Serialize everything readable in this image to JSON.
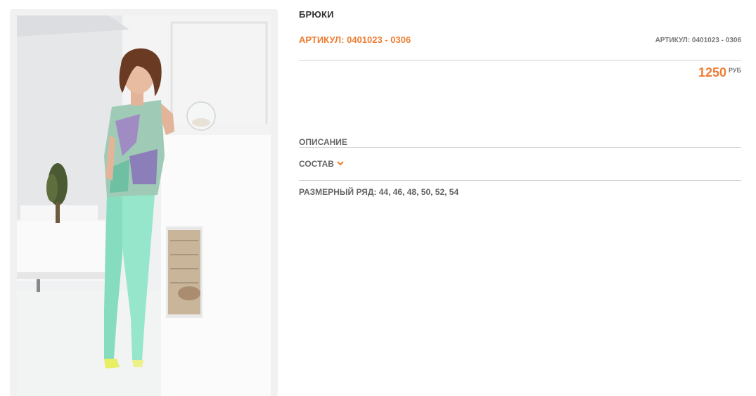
{
  "product": {
    "title": "БРЮКИ",
    "sku_main": "АРТИКУЛ: 0401023 - 0306",
    "sku_small": "АРТИКУЛ: 0401023 - 0306",
    "price_value": "1250",
    "price_unit": "РУБ"
  },
  "sections": {
    "description_label": "ОПИСАНИЕ",
    "composition_label": "СОСТАВ",
    "sizes_text": "РАЗМЕРНЫЙ РЯД: 44, 46, 48, 50, 52, 54"
  },
  "colors": {
    "accent": "#ee7d33",
    "text": "#333333",
    "muted": "#777777",
    "rule": "#cfcfcf"
  },
  "icons": {
    "composition_toggle": "chevron-down-icon"
  }
}
